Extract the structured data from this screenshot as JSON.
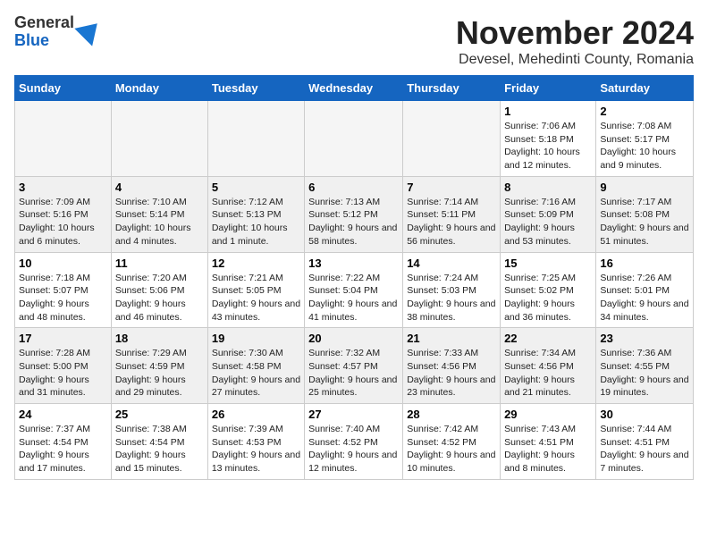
{
  "header": {
    "logo": {
      "line1": "General",
      "line2": "Blue"
    },
    "title": "November 2024",
    "subtitle": "Devesel, Mehedinti County, Romania"
  },
  "weekdays": [
    "Sunday",
    "Monday",
    "Tuesday",
    "Wednesday",
    "Thursday",
    "Friday",
    "Saturday"
  ],
  "weeks": [
    [
      {
        "day": "",
        "info": ""
      },
      {
        "day": "",
        "info": ""
      },
      {
        "day": "",
        "info": ""
      },
      {
        "day": "",
        "info": ""
      },
      {
        "day": "",
        "info": ""
      },
      {
        "day": "1",
        "info": "Sunrise: 7:06 AM\nSunset: 5:18 PM\nDaylight: 10 hours and 12 minutes."
      },
      {
        "day": "2",
        "info": "Sunrise: 7:08 AM\nSunset: 5:17 PM\nDaylight: 10 hours and 9 minutes."
      }
    ],
    [
      {
        "day": "3",
        "info": "Sunrise: 7:09 AM\nSunset: 5:16 PM\nDaylight: 10 hours and 6 minutes."
      },
      {
        "day": "4",
        "info": "Sunrise: 7:10 AM\nSunset: 5:14 PM\nDaylight: 10 hours and 4 minutes."
      },
      {
        "day": "5",
        "info": "Sunrise: 7:12 AM\nSunset: 5:13 PM\nDaylight: 10 hours and 1 minute."
      },
      {
        "day": "6",
        "info": "Sunrise: 7:13 AM\nSunset: 5:12 PM\nDaylight: 9 hours and 58 minutes."
      },
      {
        "day": "7",
        "info": "Sunrise: 7:14 AM\nSunset: 5:11 PM\nDaylight: 9 hours and 56 minutes."
      },
      {
        "day": "8",
        "info": "Sunrise: 7:16 AM\nSunset: 5:09 PM\nDaylight: 9 hours and 53 minutes."
      },
      {
        "day": "9",
        "info": "Sunrise: 7:17 AM\nSunset: 5:08 PM\nDaylight: 9 hours and 51 minutes."
      }
    ],
    [
      {
        "day": "10",
        "info": "Sunrise: 7:18 AM\nSunset: 5:07 PM\nDaylight: 9 hours and 48 minutes."
      },
      {
        "day": "11",
        "info": "Sunrise: 7:20 AM\nSunset: 5:06 PM\nDaylight: 9 hours and 46 minutes."
      },
      {
        "day": "12",
        "info": "Sunrise: 7:21 AM\nSunset: 5:05 PM\nDaylight: 9 hours and 43 minutes."
      },
      {
        "day": "13",
        "info": "Sunrise: 7:22 AM\nSunset: 5:04 PM\nDaylight: 9 hours and 41 minutes."
      },
      {
        "day": "14",
        "info": "Sunrise: 7:24 AM\nSunset: 5:03 PM\nDaylight: 9 hours and 38 minutes."
      },
      {
        "day": "15",
        "info": "Sunrise: 7:25 AM\nSunset: 5:02 PM\nDaylight: 9 hours and 36 minutes."
      },
      {
        "day": "16",
        "info": "Sunrise: 7:26 AM\nSunset: 5:01 PM\nDaylight: 9 hours and 34 minutes."
      }
    ],
    [
      {
        "day": "17",
        "info": "Sunrise: 7:28 AM\nSunset: 5:00 PM\nDaylight: 9 hours and 31 minutes."
      },
      {
        "day": "18",
        "info": "Sunrise: 7:29 AM\nSunset: 4:59 PM\nDaylight: 9 hours and 29 minutes."
      },
      {
        "day": "19",
        "info": "Sunrise: 7:30 AM\nSunset: 4:58 PM\nDaylight: 9 hours and 27 minutes."
      },
      {
        "day": "20",
        "info": "Sunrise: 7:32 AM\nSunset: 4:57 PM\nDaylight: 9 hours and 25 minutes."
      },
      {
        "day": "21",
        "info": "Sunrise: 7:33 AM\nSunset: 4:56 PM\nDaylight: 9 hours and 23 minutes."
      },
      {
        "day": "22",
        "info": "Sunrise: 7:34 AM\nSunset: 4:56 PM\nDaylight: 9 hours and 21 minutes."
      },
      {
        "day": "23",
        "info": "Sunrise: 7:36 AM\nSunset: 4:55 PM\nDaylight: 9 hours and 19 minutes."
      }
    ],
    [
      {
        "day": "24",
        "info": "Sunrise: 7:37 AM\nSunset: 4:54 PM\nDaylight: 9 hours and 17 minutes."
      },
      {
        "day": "25",
        "info": "Sunrise: 7:38 AM\nSunset: 4:54 PM\nDaylight: 9 hours and 15 minutes."
      },
      {
        "day": "26",
        "info": "Sunrise: 7:39 AM\nSunset: 4:53 PM\nDaylight: 9 hours and 13 minutes."
      },
      {
        "day": "27",
        "info": "Sunrise: 7:40 AM\nSunset: 4:52 PM\nDaylight: 9 hours and 12 minutes."
      },
      {
        "day": "28",
        "info": "Sunrise: 7:42 AM\nSunset: 4:52 PM\nDaylight: 9 hours and 10 minutes."
      },
      {
        "day": "29",
        "info": "Sunrise: 7:43 AM\nSunset: 4:51 PM\nDaylight: 9 hours and 8 minutes."
      },
      {
        "day": "30",
        "info": "Sunrise: 7:44 AM\nSunset: 4:51 PM\nDaylight: 9 hours and 7 minutes."
      }
    ]
  ]
}
